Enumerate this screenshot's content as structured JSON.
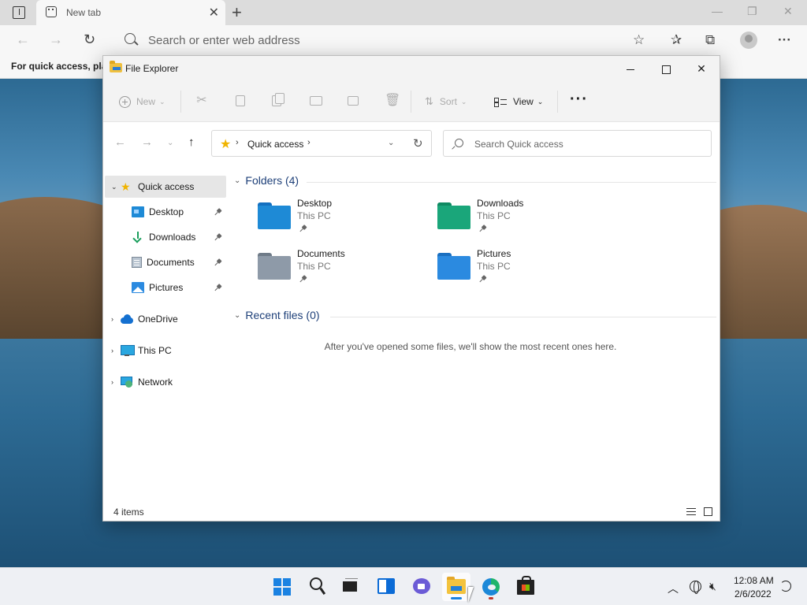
{
  "browser": {
    "tab_title": "New tab",
    "address_placeholder": "Search or enter web address",
    "favorites_hint": "For quick access, plac",
    "icons": [
      "tab-actions-icon",
      "back-icon",
      "forward-icon",
      "refresh-icon",
      "search-icon",
      "add-favorite-icon",
      "favorites-icon",
      "collections-icon",
      "profile-icon",
      "more-icon"
    ]
  },
  "explorer": {
    "title": "File Explorer",
    "commands": {
      "new_label": "New",
      "sort_label": "Sort",
      "view_label": "View",
      "more_label": "···"
    },
    "address": {
      "location": "Quick access",
      "search_placeholder": "Search Quick access"
    },
    "nav": {
      "quick_access": "Quick access",
      "pinned": [
        {
          "label": "Desktop",
          "icon": "desktop-icon"
        },
        {
          "label": "Downloads",
          "icon": "download-icon"
        },
        {
          "label": "Documents",
          "icon": "documents-icon"
        },
        {
          "label": "Pictures",
          "icon": "pictures-icon"
        }
      ],
      "onedrive": "OneDrive",
      "this_pc": "This PC",
      "network": "Network"
    },
    "folders_header": "Folders (4)",
    "folders": [
      {
        "name": "Desktop",
        "location": "This PC",
        "color": "#1e8ad6"
      },
      {
        "name": "Downloads",
        "location": "This PC",
        "color": "#1aa67a"
      },
      {
        "name": "Documents",
        "location": "This PC",
        "color": "#8e9aa8"
      },
      {
        "name": "Pictures",
        "location": "This PC",
        "color": "#2b8ae0"
      }
    ],
    "recent_header": "Recent files (0)",
    "recent_empty": "After you've opened some files, we'll show the most recent ones here.",
    "status_count": "4 items"
  },
  "taskbar": {
    "apps": [
      "start-icon",
      "search-icon",
      "task-view-icon",
      "widgets-icon",
      "chat-icon",
      "file-explorer-icon",
      "edge-icon",
      "store-icon"
    ],
    "time": "12:08 AM",
    "date": "2/6/2022"
  },
  "colors": {
    "accent": "#1a82e2",
    "selected_nav": "#e6e6e6",
    "section_header": "#1d3f78"
  }
}
